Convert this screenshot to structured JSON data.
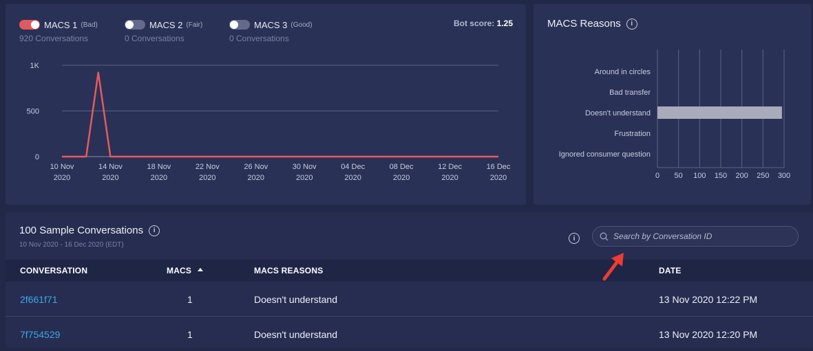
{
  "legend": [
    {
      "label": "MACS 1",
      "quality": "(Bad)",
      "count": "920 Conversations",
      "enabled": true
    },
    {
      "label": "MACS 2",
      "quality": "(Fair)",
      "count": "0 Conversations",
      "enabled": false
    },
    {
      "label": "MACS 3",
      "quality": "(Good)",
      "count": "0 Conversations",
      "enabled": false
    }
  ],
  "bot_score": {
    "label": "Bot score:",
    "value": "1.25"
  },
  "reasons": {
    "title": "MACS Reasons"
  },
  "table": {
    "title": "100 Sample Conversations",
    "date_range": "10 Nov 2020 - 16 Dec 2020 (EDT)",
    "search_placeholder": "Search by Conversation ID",
    "columns": [
      "CONVERSATION",
      "MACS",
      "MACS REASONS",
      "DATE"
    ],
    "rows": [
      {
        "id": "2f661f71",
        "macs": "1",
        "reason": "Doesn't understand",
        "date": "13 Nov 2020 12:22 PM"
      },
      {
        "id": "7f754529",
        "macs": "1",
        "reason": "Doesn't understand",
        "date": "13 Nov 2020 12:20 PM"
      }
    ]
  },
  "colors": {
    "series": "#e85a5f",
    "bar": "#a9abbb",
    "link": "#3da7e8"
  },
  "icons": [
    "info-icon",
    "search-icon",
    "sort-ascending-icon",
    "annotation-arrow"
  ],
  "chart_data": [
    {
      "type": "line",
      "x": [
        "10 Nov 2020",
        "11 Nov 2020",
        "12 Nov 2020",
        "13 Nov 2020",
        "14 Nov 2020",
        "15 Nov 2020",
        "16 Dec 2020"
      ],
      "series": [
        {
          "name": "MACS 1",
          "values": [
            0,
            0,
            0,
            920,
            0,
            0,
            0
          ]
        }
      ],
      "x_ticks": [
        [
          "10 Nov",
          "2020"
        ],
        [
          "14 Nov",
          "2020"
        ],
        [
          "18 Nov",
          "2020"
        ],
        [
          "22 Nov",
          "2020"
        ],
        [
          "26 Nov",
          "2020"
        ],
        [
          "30 Nov",
          "2020"
        ],
        [
          "04 Dec",
          "2020"
        ],
        [
          "08 Dec",
          "2020"
        ],
        [
          "12 Dec",
          "2020"
        ],
        [
          "16 Dec",
          "2020"
        ]
      ],
      "y_ticks": [
        "0",
        "500",
        "1K"
      ],
      "ylim": [
        0,
        1000
      ],
      "grid": true
    },
    {
      "type": "bar",
      "orientation": "horizontal",
      "categories": [
        "Around in circles",
        "Bad transfer",
        "Doesn't understand",
        "Frustration",
        "Ignored consumer question"
      ],
      "values": [
        0,
        0,
        295,
        0,
        0
      ],
      "x_ticks": [
        "0",
        "50",
        "100",
        "150",
        "200",
        "250",
        "300"
      ],
      "xlim": [
        0,
        300
      ],
      "grid": true
    }
  ]
}
